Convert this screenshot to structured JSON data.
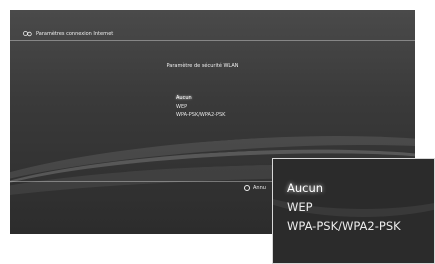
{
  "header": {
    "title": "Paramètres connexion Internet"
  },
  "dialog": {
    "title": "Paramètre de sécurité WLAN"
  },
  "options": [
    {
      "label": "Aucun",
      "selected": true
    },
    {
      "label": "WEP",
      "selected": false
    },
    {
      "label": "WPA-PSK/WPA2-PSK",
      "selected": false
    }
  ],
  "footer": {
    "back_label": "Annu"
  }
}
